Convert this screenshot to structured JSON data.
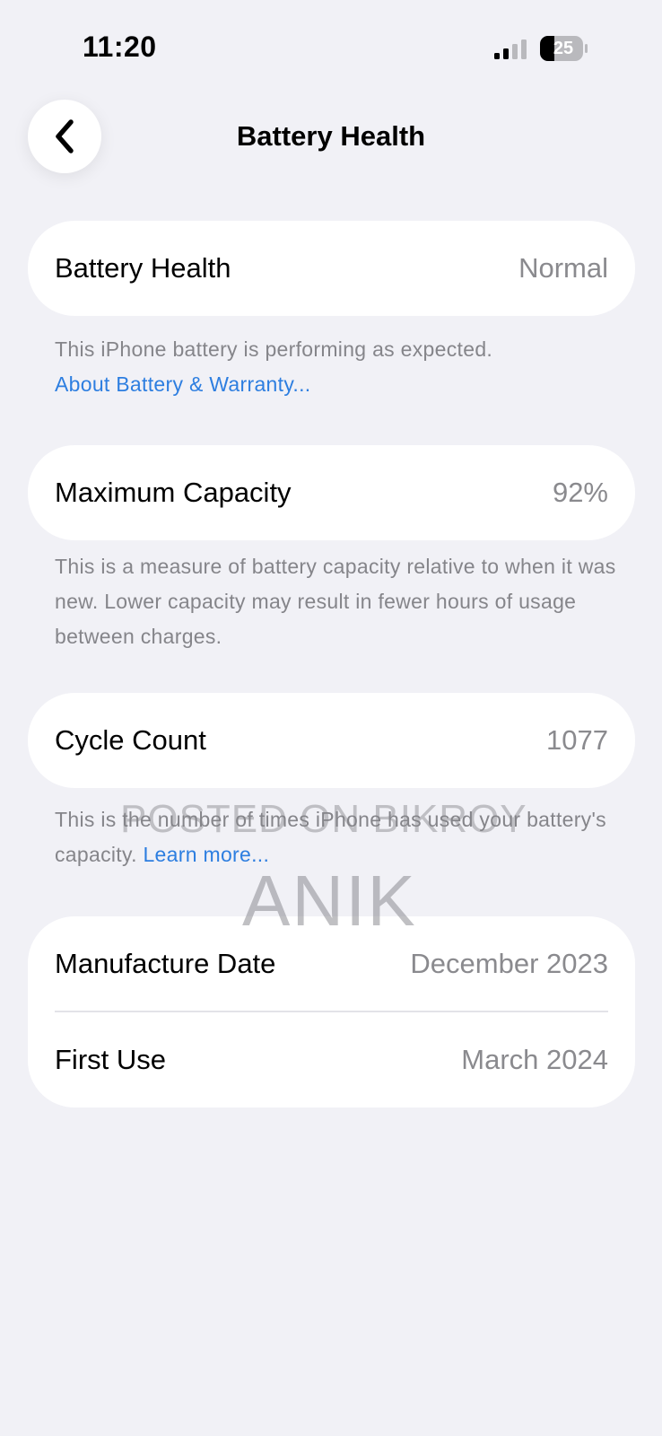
{
  "status_bar": {
    "time": "11:20",
    "battery_level": "25",
    "icons": [
      "signal-icon",
      "battery-icon"
    ]
  },
  "nav": {
    "back_icon": "chevron-left-icon",
    "title": "Battery Health"
  },
  "battery_health": {
    "label": "Battery Health",
    "value": "Normal",
    "footnote": "This iPhone battery is performing as expected.",
    "link": "About Battery & Warranty..."
  },
  "max_capacity": {
    "label": "Maximum Capacity",
    "value": "92%",
    "footnote": "This is a measure of battery capacity relative to when it was new. Lower capacity may result in fewer hours of usage between charges."
  },
  "cycle_count": {
    "label": "Cycle Count",
    "value": "1077",
    "footnote": "This is the number of times iPhone has used your battery's capacity.",
    "link": "Learn more..."
  },
  "dates": {
    "manufacture_label": "Manufacture Date",
    "manufacture_value": "December 2023",
    "first_use_label": "First Use",
    "first_use_value": "March 2024"
  },
  "watermark": {
    "line1": "POSTED ON BIKROY",
    "line2": "ANIK"
  },
  "colors": {
    "background": "#f1f1f6",
    "card": "#ffffff",
    "secondary_text": "#8a8a8e",
    "link": "#2d7ee0"
  }
}
